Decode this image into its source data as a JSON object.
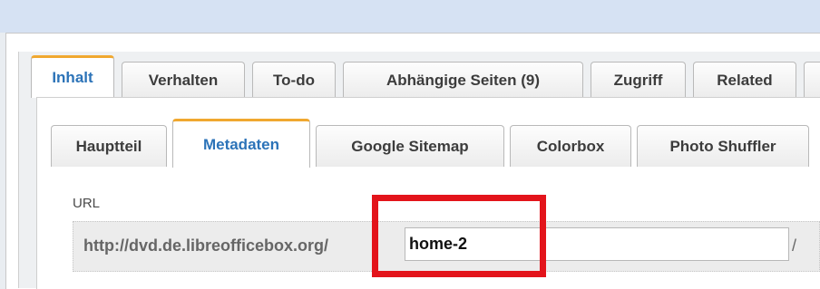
{
  "outer_tabs": [
    {
      "label": "Inhalt",
      "active": true
    },
    {
      "label": "Verhalten",
      "active": false
    },
    {
      "label": "To-do",
      "active": false
    },
    {
      "label": "Abhängige Seiten (9)",
      "active": false
    },
    {
      "label": "Zugriff",
      "active": false
    },
    {
      "label": "Related",
      "active": false
    }
  ],
  "inner_tabs": [
    {
      "label": "Hauptteil",
      "active": false
    },
    {
      "label": "Metadaten",
      "active": true
    },
    {
      "label": "Google Sitemap",
      "active": false
    },
    {
      "label": "Colorbox",
      "active": false
    },
    {
      "label": "Photo Shuffler",
      "active": false
    }
  ],
  "url_field": {
    "label": "URL",
    "prefix": "http://dvd.de.libreofficebox.org/",
    "value": "home-2",
    "suffix": "/"
  },
  "colors": {
    "accent": "#2c73b8",
    "active_tab_top": "#f0a830",
    "highlight": "#e3141b"
  }
}
